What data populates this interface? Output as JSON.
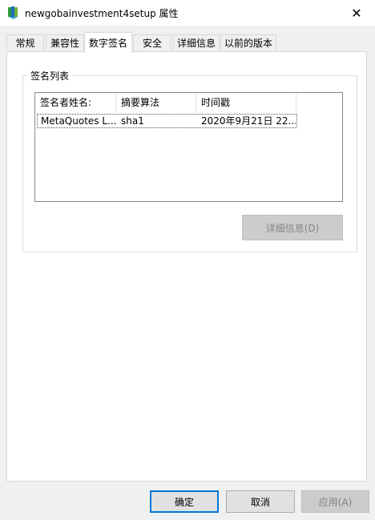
{
  "window": {
    "title": "newgobainvestment4setup 属性",
    "close_glyph": "✕"
  },
  "tabs": [
    {
      "label": "常规",
      "active": false
    },
    {
      "label": "兼容性",
      "active": false
    },
    {
      "label": "数字签名",
      "active": true
    },
    {
      "label": "安全",
      "active": false
    },
    {
      "label": "详细信息",
      "active": false
    },
    {
      "label": "以前的版本",
      "active": false
    }
  ],
  "signature_group": {
    "label": "签名列表",
    "columns": [
      "签名者姓名:",
      "摘要算法",
      "时间戳"
    ],
    "rows": [
      {
        "signer": "MetaQuotes L...",
        "digest": "sha1",
        "timestamp": "2020年9月21日 22..."
      }
    ],
    "details_button": "详细信息(D)"
  },
  "footer": {
    "ok": "确定",
    "cancel": "取消",
    "apply": "应用(A)"
  },
  "colors": {
    "focus_border": "#0078d7",
    "disabled_text": "#838383"
  }
}
